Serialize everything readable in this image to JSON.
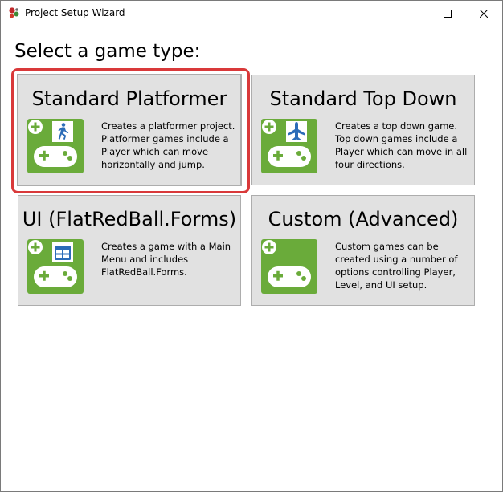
{
  "window": {
    "title": "Project Setup Wizard",
    "app_icon": "flatredball-logo-icon",
    "controls": [
      "minimize-icon",
      "maximize-icon",
      "close-icon"
    ]
  },
  "heading": "Select a game type:",
  "colors": {
    "accent_green": "#6aab3a",
    "selection_red": "#d9393a",
    "badge_blue": "#2b6cb8",
    "card_bg": "#e1e1e1"
  },
  "cards": [
    {
      "title": "Standard Platformer",
      "description": "Creates a platformer project. Platformer games include a Player which can move horizontally and jump.",
      "icon": "platformer-gamepad-icon",
      "badge": "running-person-icon",
      "selected": true
    },
    {
      "title": "Standard Top Down",
      "description": "Creates a top down game. Top down games include a Player which can move in all four directions.",
      "icon": "topdown-gamepad-icon",
      "badge": "airplane-icon",
      "selected": false
    },
    {
      "title": "UI (FlatRedBall.Forms)",
      "description": "Creates a game with a Main Menu and includes FlatRedBall.Forms.",
      "icon": "ui-gamepad-icon",
      "badge": "window-grid-icon",
      "selected": false
    },
    {
      "title": "Custom (Advanced)",
      "description": "Custom games can be created using a number of options controlling Player, Level, and UI setup.",
      "icon": "custom-gamepad-icon",
      "badge": "",
      "selected": false
    }
  ]
}
